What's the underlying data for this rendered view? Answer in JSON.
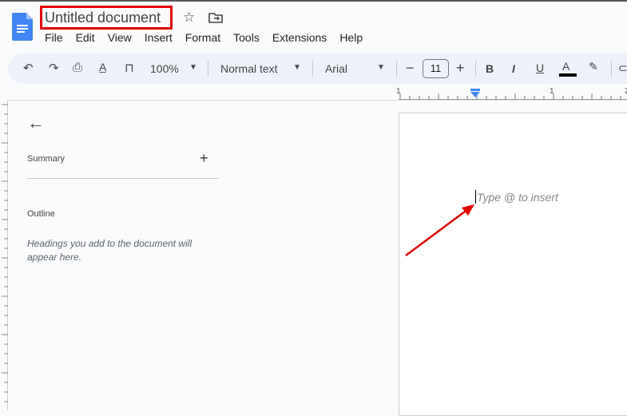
{
  "document": {
    "title": "Untitled document"
  },
  "menu": [
    "File",
    "Edit",
    "View",
    "Insert",
    "Format",
    "Tools",
    "Extensions",
    "Help"
  ],
  "toolbar": {
    "zoom": "100%",
    "style": "Normal text",
    "font": "Arial",
    "font_size": "11",
    "text_color": "#000000"
  },
  "ruler": {
    "labels": [
      "1",
      "1",
      "2"
    ]
  },
  "sidebar": {
    "summary_label": "Summary",
    "outline_label": "Outline",
    "outline_hint": "Headings you add to the document will appear here."
  },
  "page": {
    "placeholder": "Type @ to insert"
  },
  "colors": {
    "annotation": "#e00000",
    "toolbar_bg": "#edf2fa",
    "accent": "#4285f4"
  }
}
